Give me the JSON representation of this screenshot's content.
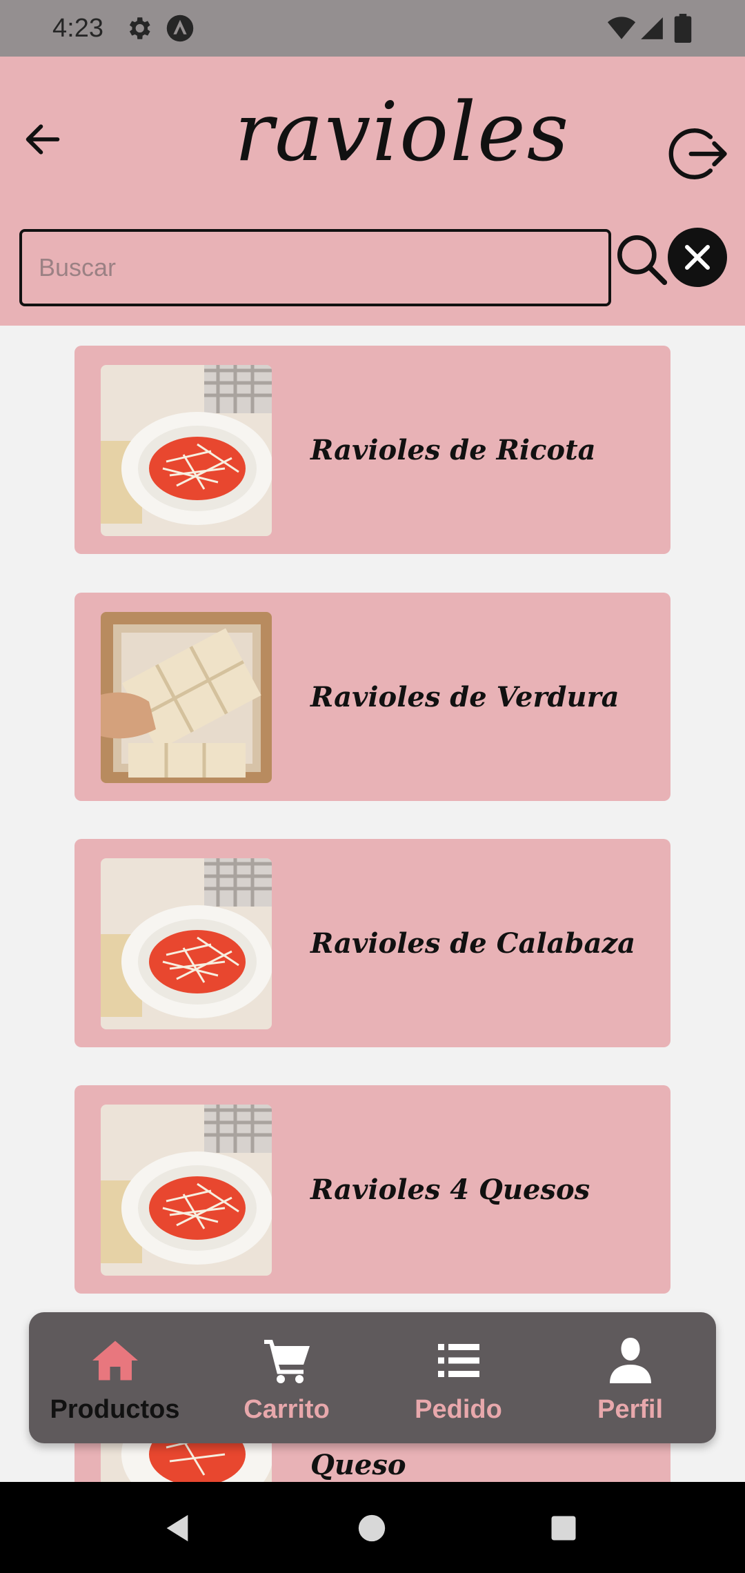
{
  "status": {
    "time": "4:23"
  },
  "header": {
    "title": "ravioles"
  },
  "search": {
    "placeholder": "Buscar",
    "value": ""
  },
  "products": [
    {
      "name": "Ravioles de Ricota",
      "image": "ravioli-tomato-plate"
    },
    {
      "name": "Ravioles de Verdura",
      "image": "fresh-ravioli-sheet"
    },
    {
      "name": "Ravioles de Calabaza",
      "image": "ravioli-tomato-plate"
    },
    {
      "name": "Ravioles 4 Quesos",
      "image": "ravioli-tomato-plate"
    },
    {
      "name": "Queso",
      "image": "ravioli-tomato-plate"
    }
  ],
  "nav": {
    "items": [
      {
        "label": "Productos",
        "icon": "home-icon",
        "active": true
      },
      {
        "label": "Carrito",
        "icon": "cart-icon",
        "active": false
      },
      {
        "label": "Pedido",
        "icon": "list-icon",
        "active": false
      },
      {
        "label": "Perfil",
        "icon": "user-icon",
        "active": false
      }
    ]
  },
  "colors": {
    "accent": "#e8b2b6",
    "nav_bg": "#5f5a5c",
    "nav_label": "#e8a8ac",
    "background": "#f2f2f2"
  }
}
